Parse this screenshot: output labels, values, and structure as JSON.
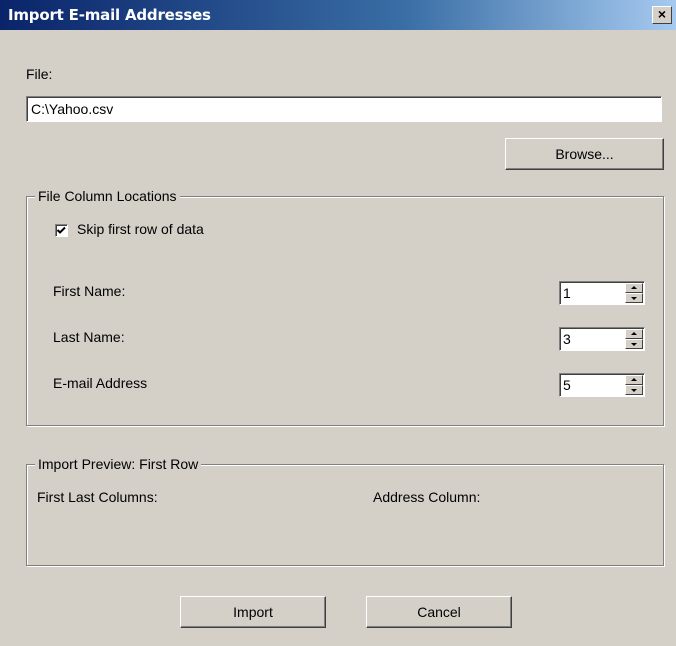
{
  "window": {
    "title": "Import E-mail Addresses",
    "close_glyph": "×"
  },
  "file": {
    "label": "File:",
    "value": "C:\\Yahoo.csv",
    "browse_label": "Browse..."
  },
  "column_locations": {
    "legend": "File Column Locations",
    "skip_first_row": {
      "label": "Skip first row of data",
      "checked": true
    },
    "first_name": {
      "label": "First Name:",
      "value": "1"
    },
    "last_name": {
      "label": "Last Name:",
      "value": "3"
    },
    "email": {
      "label": "E-mail Address",
      "value": "5"
    }
  },
  "preview": {
    "legend": "Import Preview: First Row",
    "first_last_label": "First Last Columns:",
    "address_label": "Address Column:"
  },
  "buttons": {
    "import_label": "Import",
    "cancel_label": "Cancel"
  },
  "icons": {
    "check": "checkmark-icon",
    "spin_up": "arrow-up-icon",
    "spin_down": "arrow-down-icon"
  }
}
